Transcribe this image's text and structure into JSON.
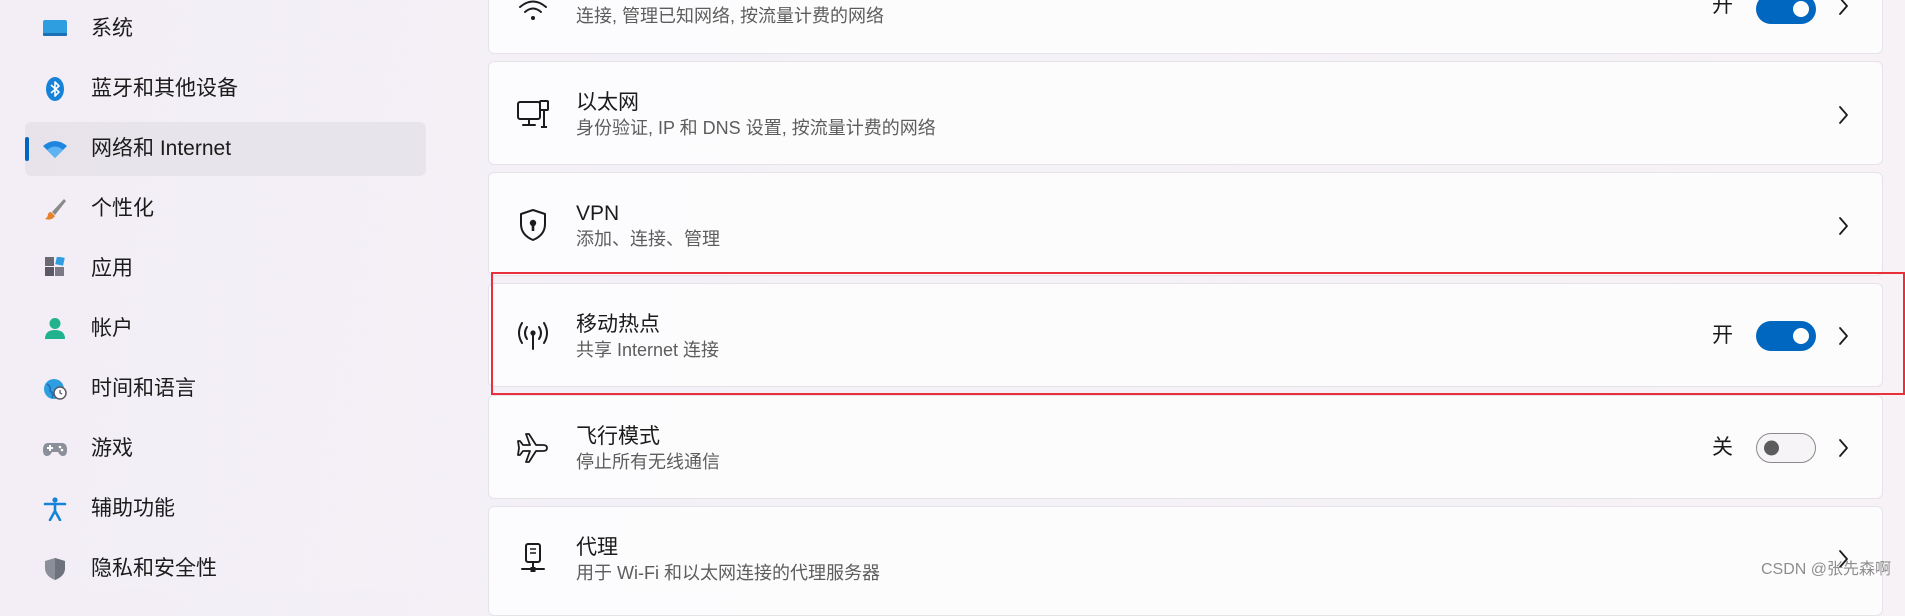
{
  "sidebar": {
    "items": [
      {
        "label": "系统",
        "icon": "system-display-icon",
        "selected": false
      },
      {
        "label": "蓝牙和其他设备",
        "icon": "bluetooth-icon",
        "selected": false
      },
      {
        "label": "网络和 Internet",
        "icon": "wifi-icon",
        "selected": true
      },
      {
        "label": "个性化",
        "icon": "paintbrush-icon",
        "selected": false
      },
      {
        "label": "应用",
        "icon": "apps-icon",
        "selected": false
      },
      {
        "label": "帐户",
        "icon": "account-person-icon",
        "selected": false
      },
      {
        "label": "时间和语言",
        "icon": "time-language-globe-icon",
        "selected": false
      },
      {
        "label": "游戏",
        "icon": "gamepad-icon",
        "selected": false
      },
      {
        "label": "辅助功能",
        "icon": "accessibility-icon",
        "selected": false
      },
      {
        "label": "隐私和安全性",
        "icon": "shield-icon",
        "selected": false
      }
    ]
  },
  "main": {
    "rows": [
      {
        "title": "",
        "description": "连接, 管理已知网络, 按流量计费的网络",
        "state_label": "开",
        "toggle_on": true,
        "icon": "wifi-icon"
      },
      {
        "title": "以太网",
        "description": "身份验证, IP 和 DNS 设置, 按流量计费的网络",
        "icon": "ethernet-computer-icon"
      },
      {
        "title": "VPN",
        "description": "添加、连接、管理",
        "icon": "vpn-shield-icon"
      },
      {
        "title": "移动热点",
        "description": "共享 Internet 连接",
        "state_label": "开",
        "toggle_on": true,
        "icon": "mobile-hotspot-icon",
        "highlighted": true
      },
      {
        "title": "飞行模式",
        "description": "停止所有无线通信",
        "state_label": "关",
        "toggle_on": false,
        "icon": "airplane-icon"
      },
      {
        "title": "代理",
        "description": "用于 Wi-Fi 和以太网连接的代理服务器",
        "icon": "proxy-server-icon"
      }
    ]
  },
  "watermark": "CSDN @张先森啊",
  "colors": {
    "accent": "#0067c0",
    "highlight_border": "#e8303a",
    "toggle_off_knob": "#5c5c5c"
  }
}
